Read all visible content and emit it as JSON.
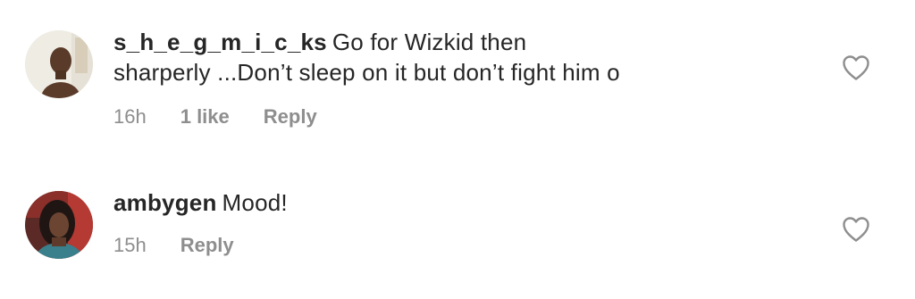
{
  "comments": [
    {
      "username": "s_h_e_g_m_i_c_ks",
      "text": "Go for Wizkid then",
      "text_line2": "sharperly ...Don’t sleep on it but don’t fight him o",
      "time": "16h",
      "likes": "1 like",
      "reply_label": "Reply",
      "icon": "heart-outline-icon"
    },
    {
      "username": "ambygen",
      "text": "Mood!",
      "time": "15h",
      "reply_label": "Reply",
      "icon": "heart-outline-icon"
    }
  ],
  "colors": {
    "text": "#262626",
    "secondary": "#8e8e8e"
  }
}
